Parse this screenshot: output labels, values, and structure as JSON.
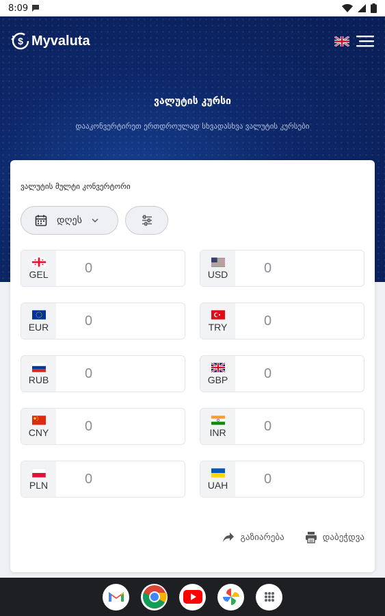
{
  "status_bar": {
    "time": "8:09"
  },
  "brand": {
    "name": "Myvaluta"
  },
  "hero": {
    "title": "ვალუტის კურსი",
    "subtitle": "დააკონვერტირეთ ერთდროულად სხვადასხვა ვალუტის კურსები"
  },
  "converter": {
    "title": "ვალუტის მულტი კონვერტორი",
    "date_label": "დღეს",
    "currencies": [
      {
        "code": "GEL",
        "value": "0",
        "flag": "georgia-flag"
      },
      {
        "code": "USD",
        "value": "0",
        "flag": "usa-flag"
      },
      {
        "code": "EUR",
        "value": "0",
        "flag": "eu-flag"
      },
      {
        "code": "TRY",
        "value": "0",
        "flag": "turkey-flag"
      },
      {
        "code": "RUB",
        "value": "0",
        "flag": "russia-flag"
      },
      {
        "code": "GBP",
        "value": "0",
        "flag": "uk-flag"
      },
      {
        "code": "CNY",
        "value": "0",
        "flag": "china-flag"
      },
      {
        "code": "INR",
        "value": "0",
        "flag": "india-flag"
      },
      {
        "code": "PLN",
        "value": "0",
        "flag": "poland-flag"
      },
      {
        "code": "UAH",
        "value": "0",
        "flag": "ukraine-flag"
      }
    ],
    "share_label": "გაზიარება",
    "print_label": "დაბეჭდვა"
  },
  "dock": [
    "gmail-icon",
    "chrome-icon",
    "youtube-icon",
    "photos-icon",
    "app-drawer-icon"
  ],
  "colors": {
    "hero_bg": "#0d2768",
    "card_bg": "#ffffff",
    "accent_blue": "#173f8f"
  }
}
